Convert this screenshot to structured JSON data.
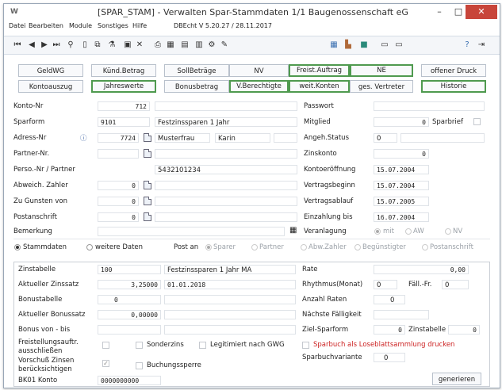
{
  "window": {
    "app_icon": "W",
    "title": "[SPAR_STAM] - Verwalten Spar-Stammdaten  1/1 Baugenossenschaft eG",
    "minimize": "–",
    "maximize": "□",
    "close": "✕"
  },
  "menu": {
    "items": [
      "Datei",
      "Bearbeiten",
      "Module",
      "Sonstiges",
      "Hilfe"
    ],
    "version": "DBEcht V 5.20.27 / 28.11.2017"
  },
  "toolbar": {
    "icons": [
      "first-record-icon",
      "prev-record-icon",
      "next-record-icon",
      "last-record-icon",
      "binoculars-icon",
      "new-doc-icon",
      "copy-icon",
      "filter-icon",
      "save-icon",
      "delete-icon",
      "print-icon",
      "print-preview-icon",
      "report-icon",
      "chart-icon",
      "tools-icon",
      "note-icon",
      "calendar-icon",
      "doc-icon",
      "book-icon",
      "folder-icon",
      "folder-open-icon",
      "help-icon",
      "exit-icon"
    ]
  },
  "buttons": {
    "row1": [
      "GeldWG",
      "Künd.Betrag",
      "SollBeträge",
      "NV",
      "Freist.Auftrag",
      "NE",
      "offener Druck"
    ],
    "row2": [
      "Kontoauszug",
      "Jahreswerte",
      "Bonusbetrag",
      "V.Berechtigte",
      "weit.Konten",
      "ges. Vertreter",
      "Historie"
    ]
  },
  "main": {
    "konto_nr_label": "Konto-Nr",
    "konto_nr": "712",
    "passwort_label": "Passwort",
    "sparform_label": "Sparform",
    "sparform_code": "9101",
    "sparform_name": "Festzinssparen 1 Jahr",
    "mitglied_label": "Mitglied",
    "mitglied_value": "0",
    "sparbrief_label": "Sparbrief",
    "adress_label": "Adress-Nr",
    "adress_nr": "7724",
    "nachname": "Musterfrau",
    "vorname": "Karin",
    "angeh_label": "Angeh.Status",
    "angeh_value": "0",
    "partner_label": "Partner-Nr.",
    "zinskonto_label": "Zinskonto",
    "zinskonto_value": "0",
    "perso_label": "Perso.-Nr / Partner",
    "perso_value": "5432101234",
    "kontoeroeffnung_label": "Kontoeröffnung",
    "kontoeroeffnung_value": "15.07.2004",
    "abweich_label": "Abweich. Zahler",
    "abweich_value": "0",
    "vertragsbeginn_label": "Vertragsbeginn",
    "vertragsbeginn_value": "15.07.2004",
    "gunsten_label": "Zu Gunsten von",
    "gunsten_value": "0",
    "vertragsablauf_label": "Vertragsablauf",
    "vertragsablauf_value": "15.07.2005",
    "postanschrift_label": "Postanschrift",
    "postanschrift_value": "0",
    "einzahlung_label": "Einzahlung bis",
    "einzahlung_value": "16.07.2004",
    "bemerkung_label": "Bemerkung",
    "veranlagung_label": "Veranlagung",
    "veranlagung_options": [
      "mit",
      "AW",
      "NV"
    ]
  },
  "view": {
    "stammdaten": "Stammdaten",
    "weitere": "weitere Daten",
    "post_an_label": "Post an",
    "post_options": [
      "Sparer",
      "Partner",
      "Abw.Zahler",
      "Begünstigter",
      "Postanschrift"
    ]
  },
  "detail": {
    "zinstabelle_label": "Zinstabelle",
    "zinstabelle_value": "100",
    "zinstabelle_name": "Festzinssparen 1 Jahr  MA",
    "rate_label": "Rate",
    "rate_value": "0,00",
    "zinssatz_label": "Aktueller Zinssatz",
    "zinssatz_value": "3,25000",
    "zinssatz_date": "01.01.2018",
    "rhythmus_label": "Rhythmus(Monat)",
    "rhythmus_value": "0",
    "faell_label": "Fäll.-Fr.",
    "faell_value": "0",
    "bonustabelle_label": "Bonustabelle",
    "bonustabelle_value": "0",
    "anzahl_label": "Anzahl Raten",
    "anzahl_value": "0",
    "bonussatz_label": "Aktueller Bonussatz",
    "bonussatz_value": "0,00000",
    "naechste_label": "Nächste Fälligkeit",
    "bonus_von_label": "Bonus von - bis",
    "ziel_label": "Ziel-Sparform",
    "ziel_value": "0",
    "zinstabelle2_label": "Zinstabelle",
    "zinstabelle2_value": "0",
    "freistellung_label_1": "Freistellungsauftr.",
    "freistellung_label_2": "ausschließen",
    "sonderzins_label": "Sonderzins",
    "legitimiert_label": "Legitimiert nach GWG",
    "sparbuch_label": "Sparbuch als Loseblattsammlung drucken",
    "sparbuchvariante_label": "Sparbuchvariante",
    "sparbuchvariante_value": "0",
    "vorschuss_label_1": "Vorschuß Zinsen",
    "vorschuss_label_2": "berücksichtigen",
    "buchungssperre_label": "Buchungssperre",
    "bk01_label": "BK01 Konto",
    "bk01_value": "0000000000",
    "generieren": "generieren"
  },
  "colors": {
    "green_border": "#4f9a4f",
    "close_red": "#c8453a",
    "warning_red": "#cc2222"
  }
}
